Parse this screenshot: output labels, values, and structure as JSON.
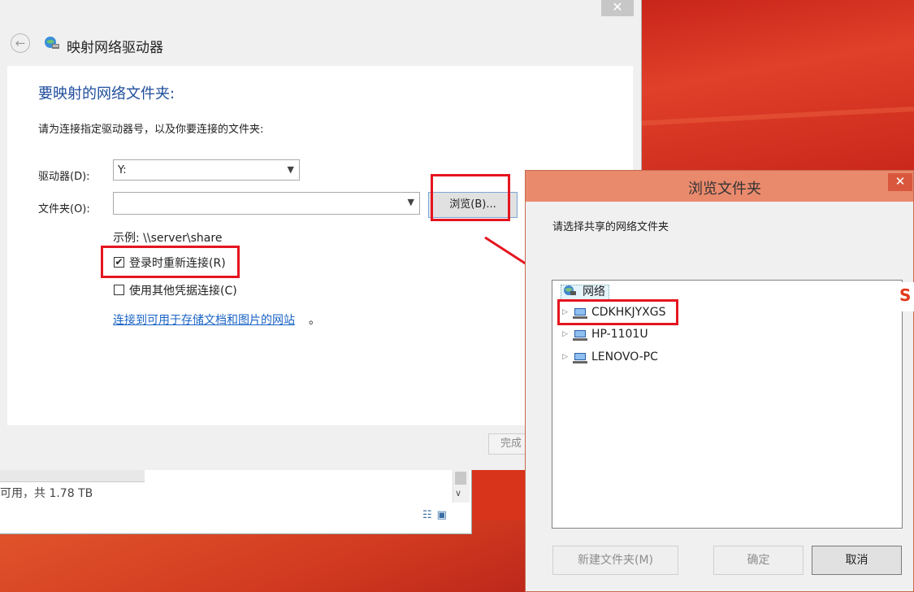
{
  "colors": {
    "accent": "#1f4e9c",
    "link": "#1a64c5",
    "highlight": "#e5151f",
    "browse_titlebar": "#ea8a6d"
  },
  "explorer": {
    "status_text": "可用，共 1.78 TB",
    "scroll_down_icon": "chevron-down-icon"
  },
  "map_dialog": {
    "title": "映射网络驱动器",
    "close_glyph": "✕",
    "back_glyph": "←",
    "heading": "要映射的网络文件夹:",
    "description": "请为连接指定驱动器号，以及你要连接的文件夹:",
    "drive_label": "驱动器(D):",
    "drive_value": "Y:",
    "folder_label": "文件夹(O):",
    "folder_value": "",
    "browse_button": "浏览(B)...",
    "example": "示例: \\\\server\\share",
    "reconnect_label": "登录时重新连接(R)",
    "reconnect_checked": true,
    "other_creds_label": "使用其他凭据连接(C)",
    "other_creds_checked": false,
    "link_text": "连接到可用于存储文档和图片的网站",
    "link_suffix": "。",
    "finish_button": "完成"
  },
  "browse_dialog": {
    "title": "浏览文件夹",
    "close_glyph": "✕",
    "prompt": "请选择共享的网络文件夹",
    "tree": {
      "root": "网络",
      "computers": [
        "CDKHKJYXGS",
        "HP-1101U",
        "LENOVO-PC"
      ]
    },
    "new_folder_button": "新建文件夹(M)",
    "ok_button": "确定",
    "cancel_button": "取消"
  },
  "watermark": "S"
}
